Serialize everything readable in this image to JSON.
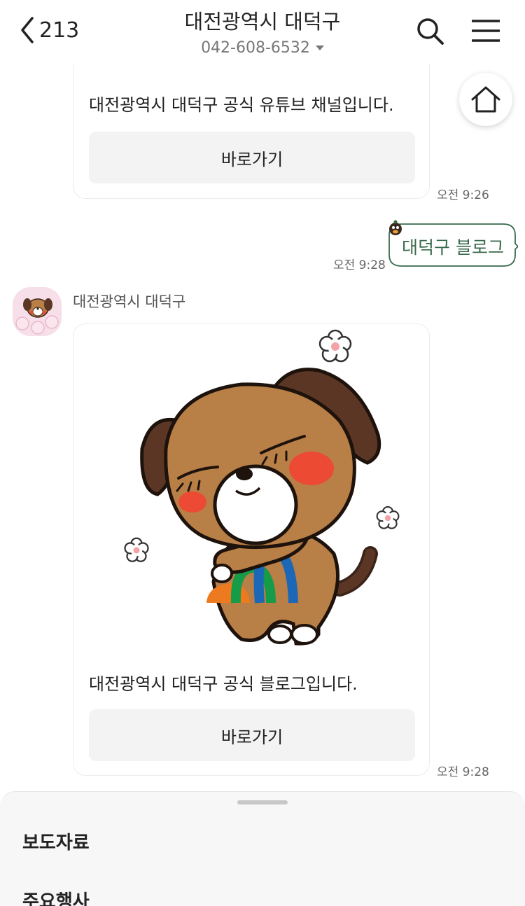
{
  "header": {
    "back_count": "213",
    "title": "대전광역시 대덕구",
    "phone": "042-608-6532"
  },
  "messages": {
    "first_card": {
      "text": "대전광역시 대덕구 공식 유튜브 채널입니다.",
      "button_label": "바로가기",
      "time": "오전 9:26"
    },
    "user_message": {
      "text": "대덕구 블로그",
      "time": "오전 9:28"
    },
    "second_card": {
      "sender": "대전광역시 대덕구",
      "text": "대전광역시 대덕구 공식 블로그입니다.",
      "button_label": "바로가기",
      "time": "오전 9:28"
    }
  },
  "bottom_sheet": {
    "items": [
      "보도자료",
      "주요행사"
    ]
  },
  "colors": {
    "accent_green": "#3a6b4c",
    "button_bg": "#f3f3f3",
    "dog_brown": "#b87f46",
    "ear_brown": "#5b3624",
    "cheek_red": "#ec4a33"
  },
  "icons": [
    "chevron-left-icon",
    "search-icon",
    "hamburger-menu-icon",
    "home-icon",
    "caret-down-icon"
  ]
}
